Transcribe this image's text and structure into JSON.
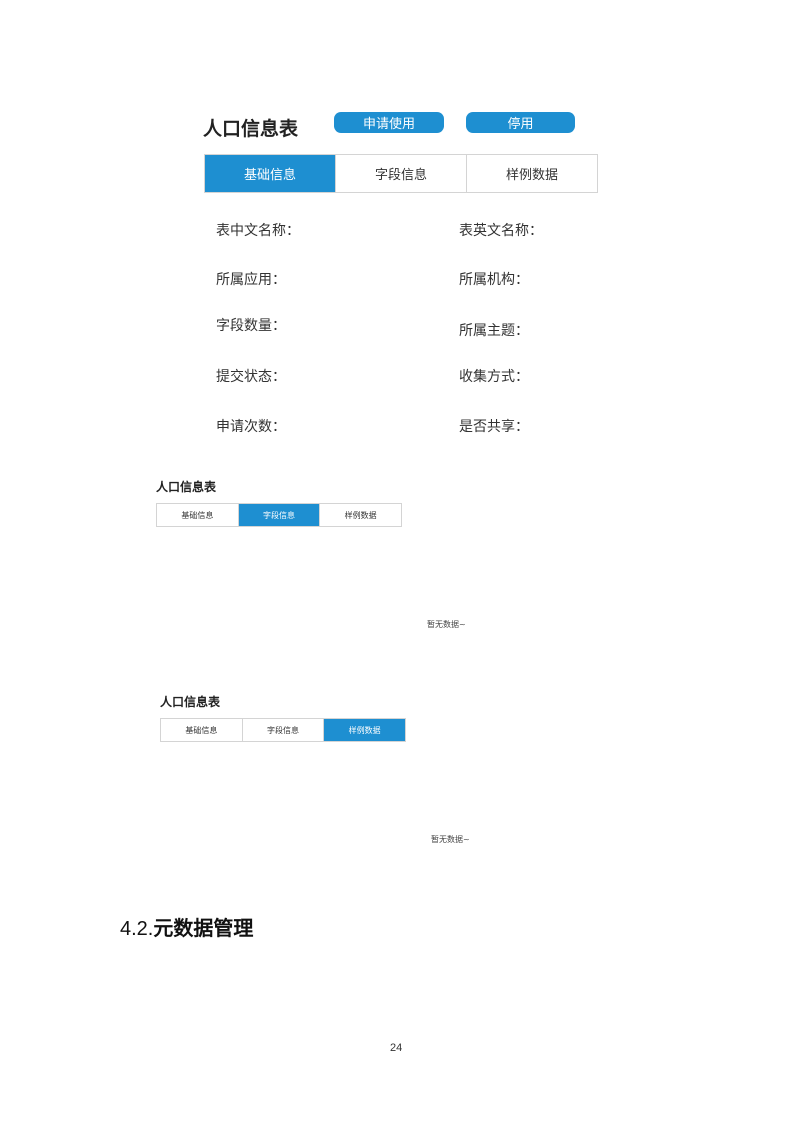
{
  "panel1": {
    "title": "人口信息表",
    "btn_apply": "申请使用",
    "btn_disable": "停用",
    "tabs": [
      "基础信息",
      "字段信息",
      "样例数据"
    ],
    "fields_left": [
      "表中文名称：",
      "所属应用：",
      "字段数量：",
      "提交状态：",
      "申请次数："
    ],
    "fields_right": [
      "表英文名称：",
      "所属机构：",
      "所属主题：",
      "收集方式：",
      "是否共享："
    ]
  },
  "panel2": {
    "title": "人口信息表",
    "tabs": [
      "基础信息",
      "字段信息",
      "样例数据"
    ],
    "empty_text": "暂无数据~"
  },
  "panel3": {
    "title": "人口信息表",
    "tabs": [
      "基础信息",
      "字段信息",
      "样例数据"
    ],
    "empty_text": "暂无数据~"
  },
  "section": {
    "number": "4.2.",
    "title": "元数据管理"
  },
  "page_number": "24",
  "colors": {
    "accent": "#1e8fd1",
    "border": "#d4d4d4"
  }
}
